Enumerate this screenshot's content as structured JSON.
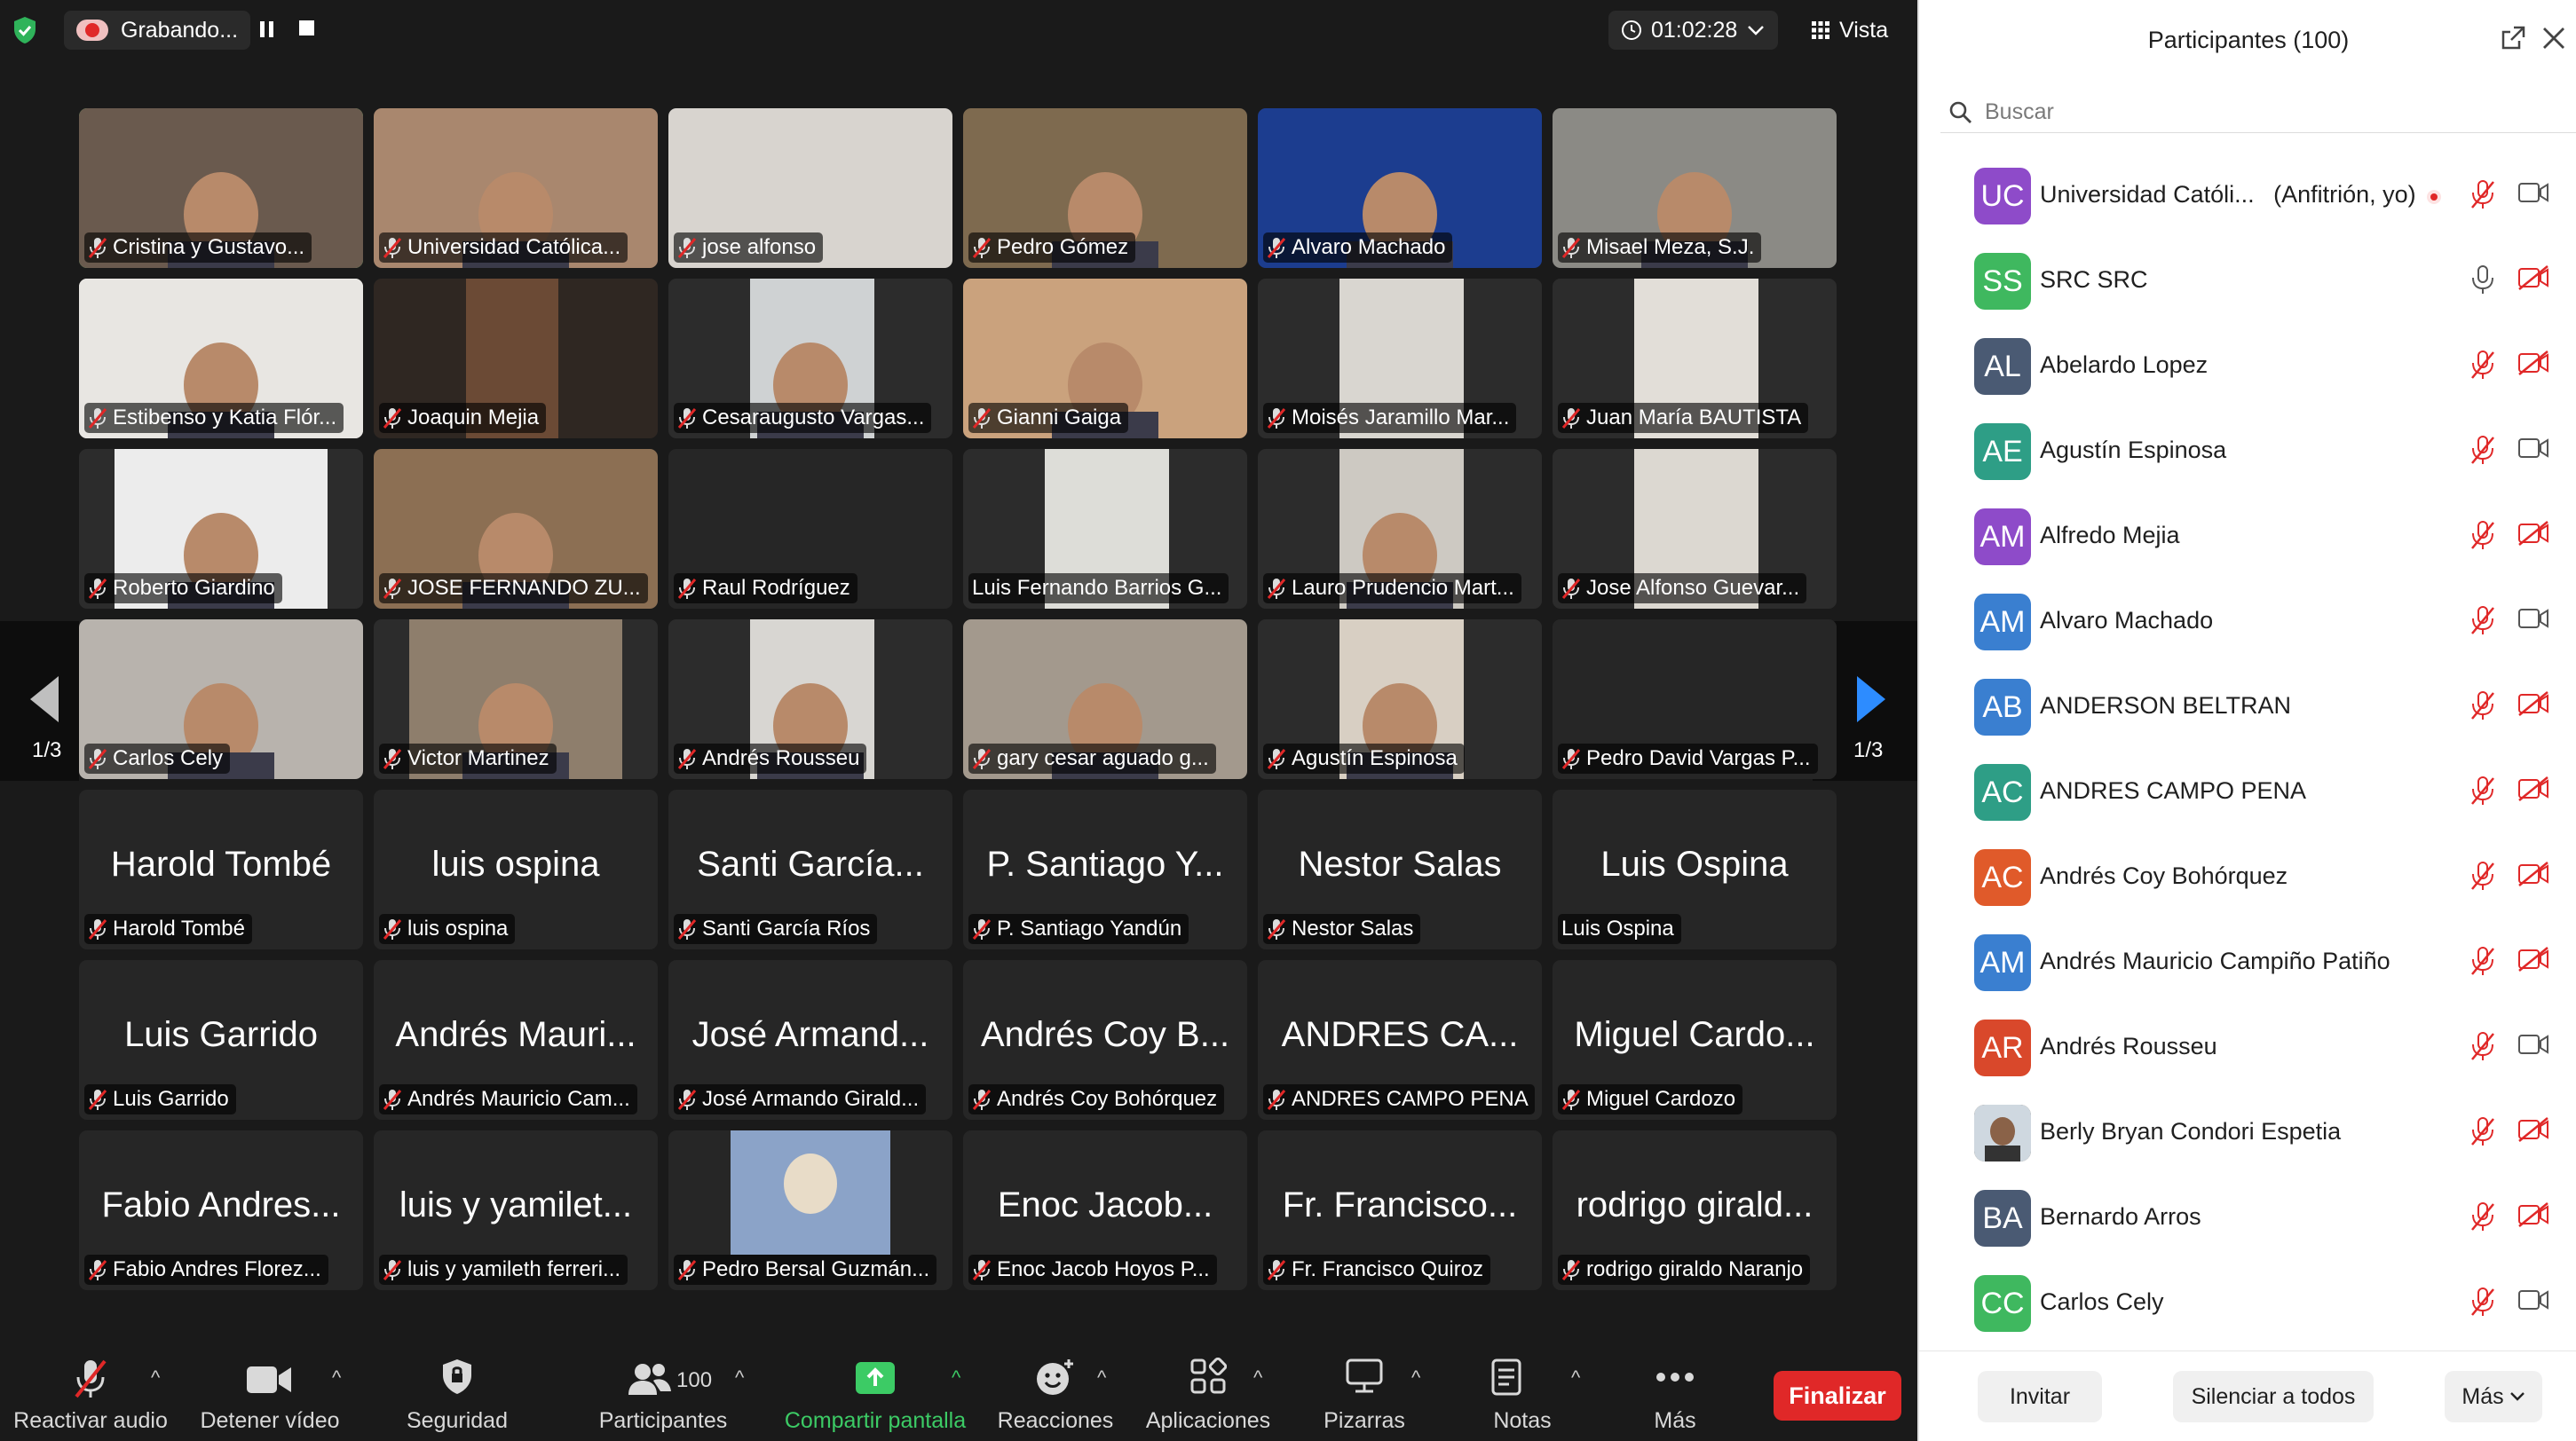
{
  "topbar": {
    "recording_label": "Grabando...",
    "timer": "01:02:28",
    "view_label": "Vista"
  },
  "gallery": {
    "page_left": "1/3",
    "page_right": "1/3",
    "tiles": [
      {
        "label": "Cristina y Gustavo...",
        "muted": true
      },
      {
        "label": "Universidad Católica...",
        "muted": true
      },
      {
        "label": "jose alfonso",
        "muted": true
      },
      {
        "label": "Pedro Gómez",
        "muted": true
      },
      {
        "label": "Alvaro Machado",
        "muted": true
      },
      {
        "label": "Misael Meza, S.J.",
        "muted": true
      },
      {
        "label": "Estibenso y Katia Flór...",
        "muted": true
      },
      {
        "label": "Joaquin Mejia",
        "muted": true
      },
      {
        "label": "Cesaraugusto Vargas...",
        "muted": true
      },
      {
        "label": "Gianni Gaiga",
        "muted": true
      },
      {
        "label": "Moisés Jaramillo Mar...",
        "muted": true
      },
      {
        "label": "Juan María BAUTISTA",
        "muted": true
      },
      {
        "label": "Roberto Giardino",
        "muted": true
      },
      {
        "label": "JOSE FERNANDO ZU...",
        "muted": true
      },
      {
        "label": "Raul Rodríguez",
        "muted": true
      },
      {
        "label": "Luis Fernando Barrios G...",
        "muted": false
      },
      {
        "label": "Lauro Prudencio Mart...",
        "muted": true
      },
      {
        "label": "Jose Alfonso Guevar...",
        "muted": true
      },
      {
        "label": "Carlos Cely",
        "muted": true
      },
      {
        "label": "Victor Martinez",
        "muted": true
      },
      {
        "label": "Andrés Rousseu",
        "muted": true
      },
      {
        "label": "gary cesar aguado g...",
        "muted": true
      },
      {
        "label": "Agustín Espinosa",
        "muted": true
      },
      {
        "label": "Pedro David Vargas P...",
        "muted": true
      },
      {
        "big": "Harold Tombé",
        "label": "Harold Tombé",
        "muted": true
      },
      {
        "big": "luis ospina",
        "label": "luis ospina",
        "muted": true
      },
      {
        "big": "Santi García...",
        "label": "Santi García Ríos",
        "muted": true
      },
      {
        "big": "P. Santiago Y...",
        "label": "P. Santiago Yandún",
        "muted": true
      },
      {
        "big": "Nestor Salas",
        "label": "Nestor Salas",
        "muted": true
      },
      {
        "big": "Luis Ospina",
        "label": "Luis Ospina",
        "muted": false
      },
      {
        "big": "Luis Garrido",
        "label": "Luis Garrido",
        "muted": true
      },
      {
        "big": "Andrés Mauri...",
        "label": "Andrés Mauricio Cam...",
        "muted": true
      },
      {
        "big": "José Armand...",
        "label": "José Armando Girald...",
        "muted": true
      },
      {
        "big": "Andrés Coy B...",
        "label": "Andrés Coy Bohórquez",
        "muted": true
      },
      {
        "big": "ANDRES CA...",
        "label": "ANDRES CAMPO PENA",
        "muted": true
      },
      {
        "big": "Miguel Cardo...",
        "label": "Miguel Cardozo",
        "muted": true
      },
      {
        "big": "Fabio Andres...",
        "label": "Fabio Andres Florez...",
        "muted": true
      },
      {
        "big": "luis y yamilet...",
        "label": "luis y yamileth  ferreri...",
        "muted": true
      },
      {
        "label": "Pedro Bersal Guzmán...",
        "muted": true
      },
      {
        "big": "Enoc  Jacob...",
        "label": "Enoc  Jacob Hoyos P...",
        "muted": true
      },
      {
        "big": "Fr. Francisco...",
        "label": "Fr. Francisco Quiroz",
        "muted": true
      },
      {
        "big": "rodrigo girald...",
        "label": "rodrigo giraldo Naranjo",
        "muted": true
      }
    ]
  },
  "toolbar": {
    "unmute": "Reactivar audio",
    "stop_video": "Detener vídeo",
    "security": "Seguridad",
    "participants": "Participantes",
    "participants_count": "100",
    "share": "Compartir pantalla",
    "reactions": "Reacciones",
    "apps": "Aplicaciones",
    "whiteboards": "Pizarras",
    "notes": "Notas",
    "more": "Más",
    "end": "Finalizar"
  },
  "panel": {
    "title": "Participantes (100)",
    "search_placeholder": "Buscar",
    "participants": [
      {
        "initials": "UC",
        "color": "#8e4bc9",
        "name": "Universidad Católi...",
        "suffix": "(Anfitrión, yo)",
        "mic": "off",
        "cam": "on",
        "recording": true
      },
      {
        "initials": "SS",
        "color": "#3fb85f",
        "name": "SRC SRC",
        "mic": "on",
        "cam": "off"
      },
      {
        "initials": "AL",
        "color": "#4a5a73",
        "name": "Abelardo Lopez",
        "mic": "off",
        "cam": "off"
      },
      {
        "initials": "AE",
        "color": "#2e9e86",
        "name": "Agustín Espinosa",
        "mic": "off",
        "cam": "on"
      },
      {
        "initials": "AM",
        "color": "#8e4bc9",
        "name": "Alfredo Mejia",
        "mic": "off",
        "cam": "off"
      },
      {
        "initials": "AM",
        "color": "#3a7fd0",
        "name": "Alvaro Machado",
        "mic": "off",
        "cam": "on"
      },
      {
        "initials": "AB",
        "color": "#3a7fd0",
        "name": "ANDERSON BELTRAN",
        "mic": "off",
        "cam": "off"
      },
      {
        "initials": "AC",
        "color": "#2e9e86",
        "name": "ANDRES CAMPO PENA",
        "mic": "off",
        "cam": "off"
      },
      {
        "initials": "AC",
        "color": "#e05a2a",
        "name": "Andrés Coy Bohórquez",
        "mic": "off",
        "cam": "off"
      },
      {
        "initials": "AM",
        "color": "#3a7fd0",
        "name": "Andrés Mauricio Campiño Patiño",
        "mic": "off",
        "cam": "off"
      },
      {
        "initials": "AR",
        "color": "#d9482b",
        "name": "Andrés Rousseu",
        "mic": "off",
        "cam": "on"
      },
      {
        "initials": "",
        "color": "#5a4a3a",
        "name": "Berly Bryan Condori Espetia",
        "mic": "off",
        "cam": "off",
        "photo": true
      },
      {
        "initials": "BA",
        "color": "#4a5a73",
        "name": "Bernardo Arros",
        "mic": "off",
        "cam": "off"
      },
      {
        "initials": "CC",
        "color": "#3fb85f",
        "name": "Carlos Cely",
        "mic": "off",
        "cam": "on"
      }
    ],
    "invite": "Invitar",
    "mute_all": "Silenciar a todos",
    "more": "Más"
  }
}
